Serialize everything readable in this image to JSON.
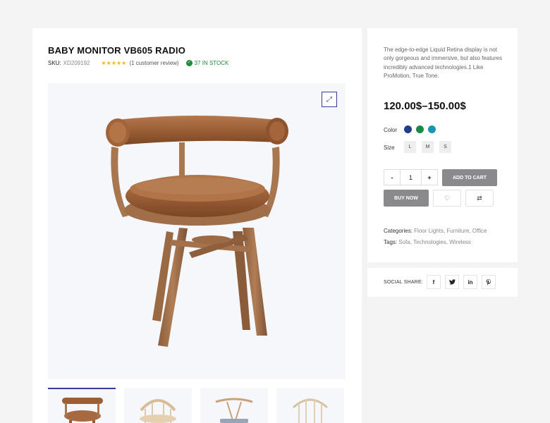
{
  "product": {
    "title": "BABY MONITOR VB605 RADIO",
    "sku_label": "SKU:",
    "sku_value": "XD209192",
    "rating_stars": 5,
    "review_text": "(1 customer review)",
    "stock_text": "37 IN STOCK"
  },
  "gallery": {
    "expand_icon": "expand-icon",
    "thumbnail_count": 4,
    "active_thumbnail": 1
  },
  "details": {
    "description": "The edge-to-edge Liquid Retina display is not only gorgeous and immersive, but also features incredibly advanced technologies.1 Like ProMotion, True Tone.",
    "price": "120.00$–150.00$",
    "color_label": "Color",
    "colors": [
      "#1f3f8c",
      "#1c8a4a",
      "#1a96b4"
    ],
    "size_label": "Size",
    "sizes": [
      "L",
      "M",
      "S"
    ],
    "quantity": "1",
    "minus_label": "-",
    "plus_label": "+",
    "add_to_cart": "ADD TO CART",
    "buy_now": "BUY NOW",
    "categories_label": "Categories:",
    "categories": "Floor Lights, Furniture, Office",
    "tags_label": "Tags:",
    "tags": "Sofa, Technologies, Wireless"
  },
  "social": {
    "label": "SOCIAL SHARE:",
    "icons": [
      "facebook-icon",
      "twitter-icon",
      "linkedin-icon",
      "pinterest-icon"
    ],
    "glyphs": [
      "f",
      "t",
      "in",
      "p"
    ]
  }
}
